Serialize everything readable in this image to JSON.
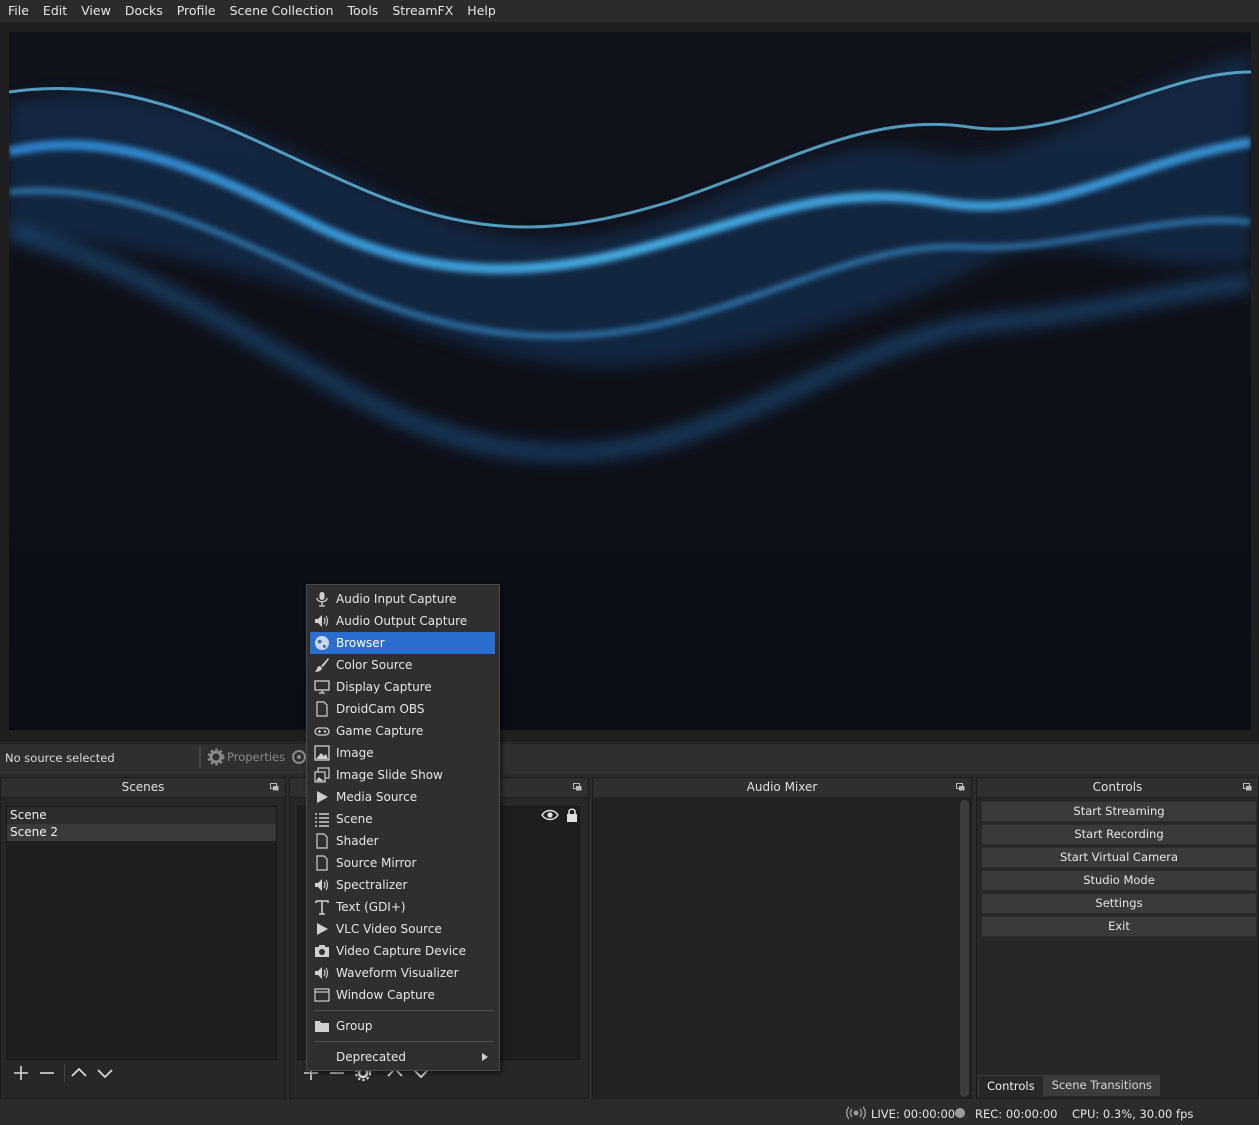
{
  "menubar": {
    "items": [
      "File",
      "Edit",
      "View",
      "Docks",
      "Profile",
      "Scene Collection",
      "Tools",
      "StreamFX",
      "Help"
    ]
  },
  "context_bar": {
    "no_source": "No source selected",
    "properties_label": "Properties"
  },
  "scenes": {
    "title": "Scenes",
    "items": [
      "Scene",
      "Scene 2"
    ]
  },
  "sources": {
    "title": ""
  },
  "mixer": {
    "title": "Audio Mixer"
  },
  "controls": {
    "title": "Controls",
    "buttons": [
      "Start Streaming",
      "Start Recording",
      "Start Virtual Camera",
      "Studio Mode",
      "Settings",
      "Exit"
    ],
    "tabs": [
      "Controls",
      "Scene Transitions"
    ]
  },
  "status": {
    "live": "LIVE: 00:00:00",
    "rec": "REC: 00:00:00",
    "cpu": "CPU: 0.3%, 30.00 fps"
  },
  "context_menu": {
    "items": [
      {
        "label": "Audio Input Capture",
        "icon": "microphone-icon"
      },
      {
        "label": "Audio Output Capture",
        "icon": "speaker-icon"
      },
      {
        "label": "Browser",
        "icon": "globe-icon"
      },
      {
        "label": "Color Source",
        "icon": "brush-icon"
      },
      {
        "label": "Display Capture",
        "icon": "monitor-icon"
      },
      {
        "label": "DroidCam OBS",
        "icon": "file-icon"
      },
      {
        "label": "Game Capture",
        "icon": "gamepad-icon"
      },
      {
        "label": "Image",
        "icon": "image-icon"
      },
      {
        "label": "Image Slide Show",
        "icon": "slideshow-icon"
      },
      {
        "label": "Media Source",
        "icon": "play-icon"
      },
      {
        "label": "Scene",
        "icon": "list-icon"
      },
      {
        "label": "Shader",
        "icon": "file-icon"
      },
      {
        "label": "Source Mirror",
        "icon": "file-icon"
      },
      {
        "label": "Spectralizer",
        "icon": "speaker-icon"
      },
      {
        "label": "Text (GDI+)",
        "icon": "text-icon"
      },
      {
        "label": "VLC Video Source",
        "icon": "play-icon"
      },
      {
        "label": "Video Capture Device",
        "icon": "camera-icon"
      },
      {
        "label": "Waveform Visualizer",
        "icon": "speaker-icon"
      },
      {
        "label": "Window Capture",
        "icon": "window-icon"
      }
    ],
    "group": {
      "label": "Group",
      "icon": "folder-icon"
    },
    "deprecated": {
      "label": "Deprecated",
      "icon": "submenu-arrow-icon"
    },
    "highlight_color": "#2a6fcf"
  }
}
